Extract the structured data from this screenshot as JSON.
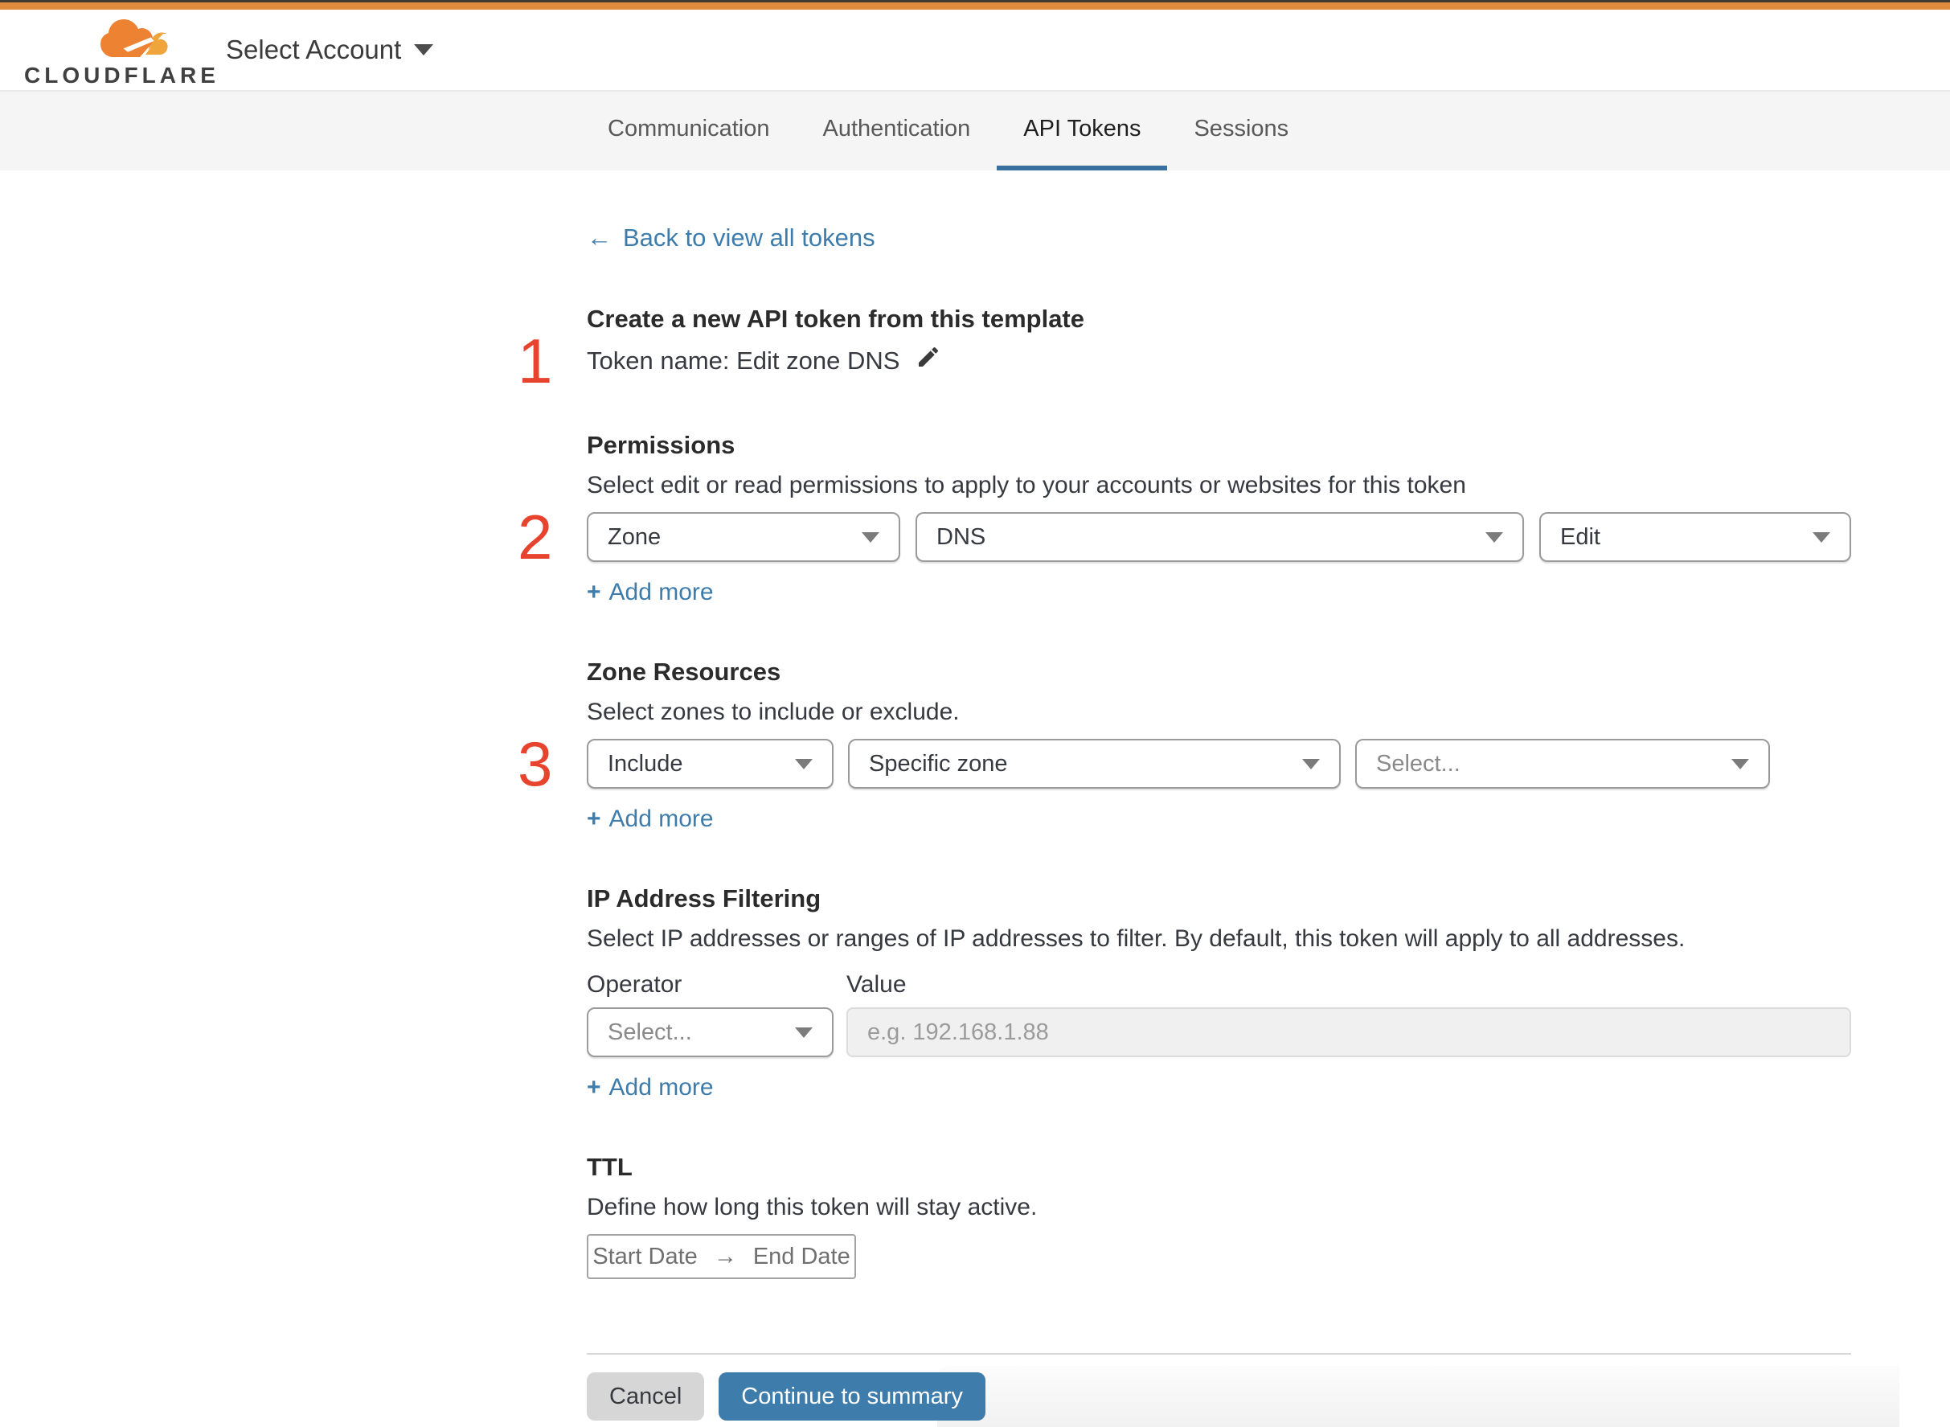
{
  "header": {
    "brand": "CLOUDFLARE",
    "account_selector": "Select Account"
  },
  "tabs": [
    {
      "label": "Communication",
      "active": false
    },
    {
      "label": "Authentication",
      "active": false
    },
    {
      "label": "API Tokens",
      "active": true
    },
    {
      "label": "Sessions",
      "active": false
    }
  ],
  "back": {
    "arrow": "←",
    "label": "Back to view all tokens"
  },
  "steps": {
    "one": "1",
    "two": "2",
    "three": "3"
  },
  "template_section": {
    "heading": "Create a new API token from this template",
    "token_name": "Token name: Edit zone DNS"
  },
  "permissions": {
    "heading": "Permissions",
    "description": "Select edit or read permissions to apply to your accounts or websites for this token",
    "selects": [
      "Zone",
      "DNS",
      "Edit"
    ],
    "add_more_plus": "+",
    "add_more_label": "Add more"
  },
  "zone_resources": {
    "heading": "Zone Resources",
    "description": "Select zones to include or exclude.",
    "selects": [
      "Include",
      "Specific zone",
      "Select..."
    ],
    "add_more_plus": "+",
    "add_more_label": "Add more"
  },
  "ip_filtering": {
    "heading": "IP Address Filtering",
    "description": "Select IP addresses or ranges of IP addresses to filter. By default, this token will apply to all addresses.",
    "operator_label": "Operator",
    "value_label": "Value",
    "operator_placeholder": "Select...",
    "value_placeholder": "e.g. 192.168.1.88",
    "add_more_plus": "+",
    "add_more_label": "Add more"
  },
  "ttl": {
    "heading": "TTL",
    "description": "Define how long this token will stay active.",
    "start_label": "Start Date",
    "arrow": "→",
    "end_label": "End Date"
  },
  "footer": {
    "cancel_label": "Cancel",
    "continue_label": "Continue to summary"
  },
  "colors": {
    "orange_bar": "#e18b3d",
    "brand_orange": "#ec8232",
    "brand_orange_light": "#f0a43c",
    "marine": "#3e7cab",
    "tab_underline": "#3b6f9f",
    "annotation_red": "#e8432e"
  }
}
